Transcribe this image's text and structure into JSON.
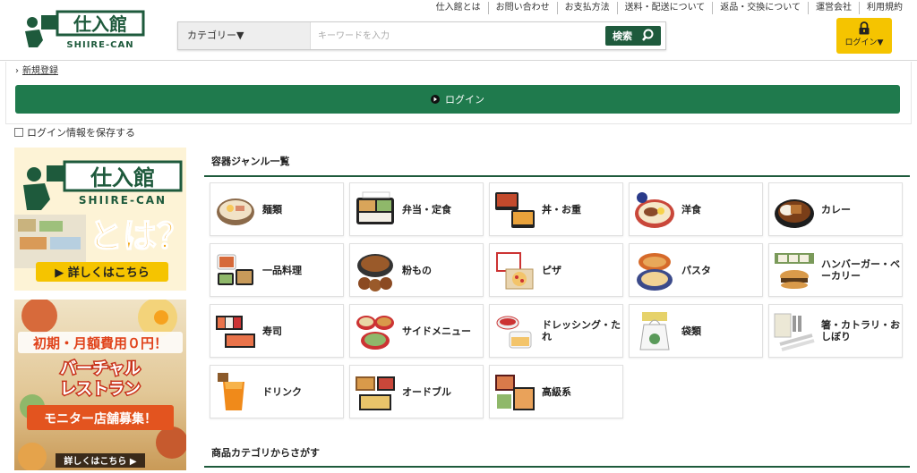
{
  "header": {
    "logo_text": "仕入館",
    "logo_sub": "SHIIRE-CAN",
    "top_links": [
      "仕入館とは",
      "お問い合わせ",
      "お支払方法",
      "送料・配送について",
      "返品・交換について",
      "運営会社",
      "利用規約"
    ],
    "search": {
      "category_label": "カテゴリー▼",
      "placeholder": "キーワードを入力",
      "button_label": "検索"
    },
    "login_label": "ログイン▼"
  },
  "login_panel": {
    "register_link": "新規登録",
    "login_button": "ログイン",
    "remember_label": "ログイン情報を保存する"
  },
  "banners": {
    "banner1": {
      "logo_text": "仕入館",
      "logo_sub": "SHIIRE-CAN",
      "headline": "とは？",
      "button": "▶ 詳しくはこちら"
    },
    "banner2": {
      "line1": "初期・月額費用０円！",
      "line2": "バーチャル",
      "line3": "レストラン",
      "line4": "モニター店舗募集！",
      "button": "詳しくはこちら ▶"
    }
  },
  "genre": {
    "title": "容器ジャンル一覧",
    "items": [
      {
        "label": "麺類",
        "icon": "noodle-bowl-icon"
      },
      {
        "label": "弁当・定食",
        "icon": "bento-icon"
      },
      {
        "label": "丼・お重",
        "icon": "donburi-icon"
      },
      {
        "label": "洋食",
        "icon": "western-food-icon"
      },
      {
        "label": "カレー",
        "icon": "curry-icon"
      },
      {
        "label": "一品料理",
        "icon": "dish-icon"
      },
      {
        "label": "粉もの",
        "icon": "konamono-icon"
      },
      {
        "label": "ピザ",
        "icon": "pizza-icon"
      },
      {
        "label": "パスタ",
        "icon": "pasta-icon"
      },
      {
        "label": "ハンバーガー・ベーカリー",
        "icon": "burger-icon"
      },
      {
        "label": "寿司",
        "icon": "sushi-icon"
      },
      {
        "label": "サイドメニュー",
        "icon": "side-menu-icon"
      },
      {
        "label": "ドレッシング・たれ",
        "icon": "dressing-icon"
      },
      {
        "label": "袋類",
        "icon": "bag-icon"
      },
      {
        "label": "箸・カトラリ・おしぼり",
        "icon": "cutlery-icon"
      },
      {
        "label": "ドリンク",
        "icon": "drink-icon"
      },
      {
        "label": "オードブル",
        "icon": "platter-icon"
      },
      {
        "label": "高級系",
        "icon": "premium-box-icon"
      }
    ]
  },
  "category_section": {
    "title": "商品カテゴリからさがす"
  },
  "colors": {
    "brand_green": "#1e5a3c",
    "login_green": "#1f7a4d",
    "login_yellow": "#f5c400"
  }
}
